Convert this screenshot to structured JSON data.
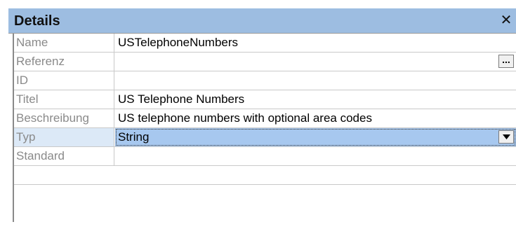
{
  "panel": {
    "title": "Details",
    "close_icon": "close-icon"
  },
  "properties": [
    {
      "label": "Name",
      "value": "USTelephoneNumbers"
    },
    {
      "label": "Referenz",
      "value": "",
      "button_label": "...",
      "button_icon": "ellipsis-icon"
    },
    {
      "label": "ID",
      "value": ""
    },
    {
      "label": "Titel",
      "value": "US Telephone Numbers"
    },
    {
      "label": "Beschreibung",
      "value": "US telephone numbers with optional area codes"
    },
    {
      "label": "Typ",
      "value": "String",
      "button_icon": "dropdown-arrow-icon",
      "selected": true
    },
    {
      "label": "Standard",
      "value": ""
    }
  ],
  "colors": {
    "titlebar": "#9dbde1",
    "selected_value": "#a7c8ef",
    "selected_label": "#dce9f7",
    "label_text": "#8a8a8a"
  }
}
